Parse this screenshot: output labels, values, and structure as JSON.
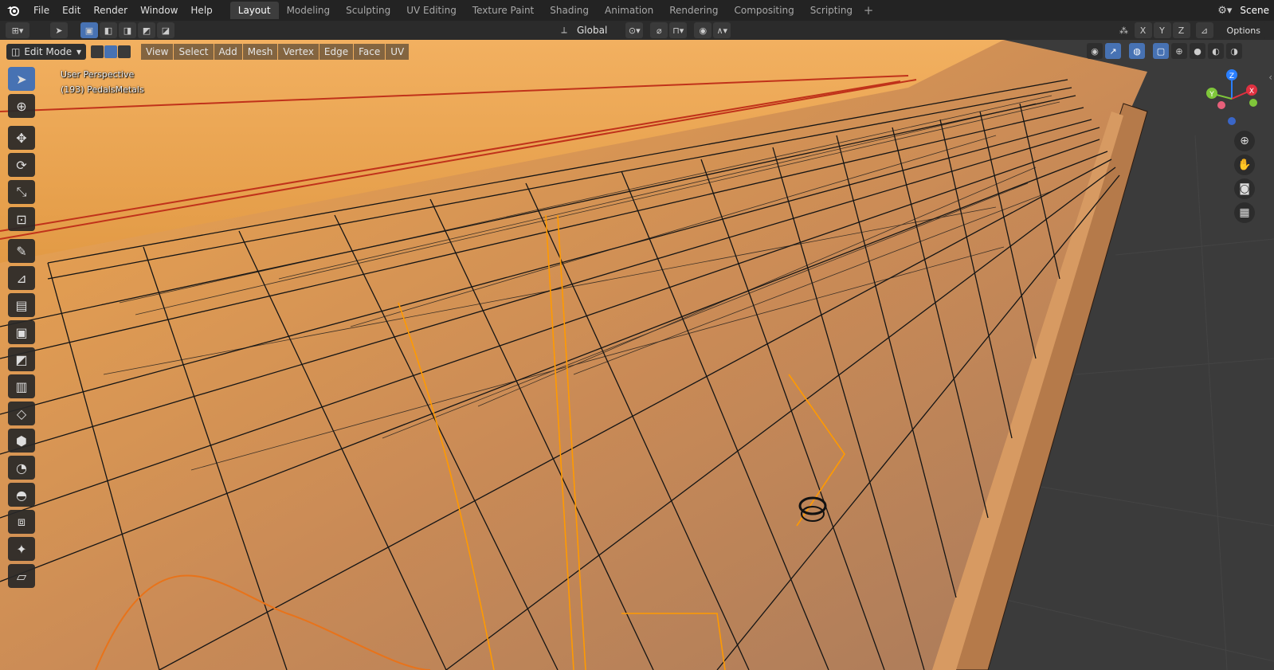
{
  "topbar": {
    "menu": [
      "File",
      "Edit",
      "Render",
      "Window",
      "Help"
    ],
    "workspaces": [
      "Layout",
      "Modeling",
      "Sculpting",
      "UV Editing",
      "Texture Paint",
      "Shading",
      "Animation",
      "Rendering",
      "Compositing",
      "Scripting"
    ],
    "active_workspace": "Layout",
    "add_workspace": "+",
    "scene": "Scene"
  },
  "header": {
    "transform_orientation": "Global",
    "options_label": "Options",
    "axis_x": "X",
    "axis_y": "Y",
    "axis_z": "Z"
  },
  "viewport": {
    "mode": "Edit Mode",
    "menus": [
      "View",
      "Select",
      "Add",
      "Mesh",
      "Vertex",
      "Edge",
      "Face",
      "UV"
    ],
    "perspective_label": "User Perspective",
    "object_label": "(193) PedalsMetals",
    "gizmo_axes": {
      "x": "X",
      "y": "Y",
      "z": "Z"
    }
  },
  "toolbar": {
    "tools": [
      "select-box",
      "cursor",
      "move",
      "rotate",
      "scale",
      "transform",
      "annotate",
      "measure",
      "extrude",
      "inset",
      "bevel",
      "loop-cut",
      "knife",
      "poly-build",
      "spin",
      "smooth",
      "edge-slide",
      "shrink-fatten",
      "shear",
      "rip"
    ],
    "active_tool": "select-box"
  },
  "colors": {
    "accent": "#4772b3",
    "selection_orange": "#f5a623",
    "wire_dark": "#111111"
  }
}
